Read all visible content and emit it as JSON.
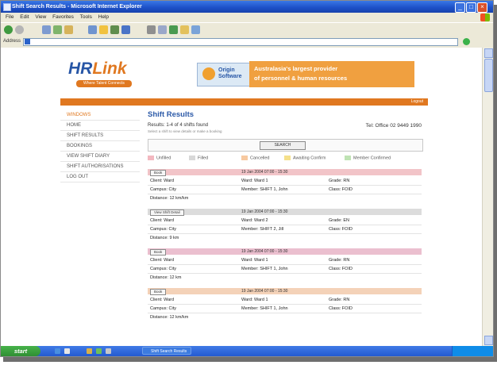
{
  "window": {
    "title": "Shift Search Results - Microsoft Internet Explorer",
    "menu": [
      "File",
      "Edit",
      "View",
      "Favorites",
      "Tools",
      "Help"
    ],
    "address_label": "Address"
  },
  "site": {
    "logo_text_a": "HR",
    "logo_text_b": "Link",
    "logo_tagline": "Where Talent Connects",
    "partner_logo": "Origin Software",
    "tagline_line1": "Australasia's largest provider",
    "tagline_line2": "of personnel & human resources",
    "logout_label": "Logout"
  },
  "leftnav": {
    "header": "WINDOWS",
    "items": [
      "HOME",
      "SHIFT RESULTS",
      "BOOKINGS",
      "VIEW SHIFT DIARY",
      "SHIFT AUTHORISATIONS",
      "LOG OUT"
    ]
  },
  "results": {
    "title": "Shift Results",
    "summary": "Results: 1-4 of 4 shifts found",
    "subnote": "Select a shift to view details or make a booking",
    "telephone": "Tel: Office 02 9449 1990",
    "search_button": "SEARCH",
    "legend": [
      {
        "label": "Unfilled",
        "color": "#f3b8c0"
      },
      {
        "label": "Filled",
        "color": "#d8d8d8"
      },
      {
        "label": "Cancelled",
        "color": "#f7c9a0"
      },
      {
        "label": "Awaiting Confirm",
        "color": "#f5e08a"
      },
      {
        "label": "Member Confirmed",
        "color": "#bfe3b4"
      }
    ],
    "shifts": [
      {
        "button": "Book",
        "date": "19 Jan 2004 07:00 - 15:30",
        "band_color": "#f2c4c8",
        "client": "Client: Ward",
        "ward": "Ward: Ward 1",
        "grade": "Grade: RN",
        "campus": "Campus: City",
        "member": "Member: SHIFT 1, John",
        "class_info": "Class: FOID",
        "distance": "Distance: 12 km/km"
      },
      {
        "button": "View Shift Detail",
        "date": "19 Jan 2004 07:00 - 15:30",
        "band_color": "#dcdcdc",
        "client": "Client: Ward",
        "ward": "Ward: Ward 2",
        "grade": "Grade: EN",
        "campus": "Campus: City",
        "member": "Member: SHIFT 2, Jill",
        "class_info": "Class: FOID",
        "distance": "Distance: 9 km"
      },
      {
        "button": "Book",
        "date": "19 Jan 2004 07:00 - 15:30",
        "band_color": "#ebbfcf",
        "client": "Client: Ward",
        "ward": "Ward: Ward 1",
        "grade": "Grade: RN",
        "campus": "Campus: City",
        "member": "Member: SHIFT 1, John",
        "class_info": "Class: FOID",
        "distance": "Distance: 12 km"
      },
      {
        "button": "Book",
        "date": "19 Jan 2004 07:00 - 15:30",
        "band_color": "#f4d2b8",
        "client": "Client: Ward",
        "ward": "Ward: Ward 1",
        "grade": "Grade: RN",
        "campus": "Campus: City",
        "member": "Member: SHIFT 1, John",
        "class_info": "Class: FOID",
        "distance": "Distance: 12 km/km"
      }
    ]
  },
  "taskbar": {
    "start_label": "start",
    "task_item": "Shift Search Results"
  }
}
